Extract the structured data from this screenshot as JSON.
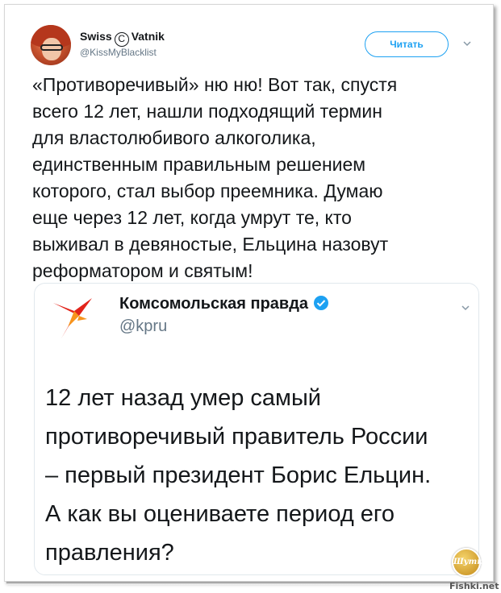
{
  "tweet": {
    "author_name_left": "Swiss",
    "author_name_symbol": "C",
    "author_name_right": "Vatnik",
    "author_handle": "@KissMyBlacklist",
    "follow_label": "Читать",
    "text": "«Противоречивый» ню ню! Вот так, спустя\nвсего 12 лет, нашли подходящий термин\nдля властолюбивого алкоголика,\nединственным правильным решением\nкоторого, стал выбор преемника. Думаю\nеще через 12 лет, когда умрут те, кто\nвыживал в девяностые, Ельцина назовут\nреформатором и святым!"
  },
  "quoted_tweet": {
    "author_name": "Комсомольская правда",
    "author_handle": "@kpru",
    "text": "12 лет назад умер самый\nпротиворечивый правитель России\n– первый президент Борис Ельцин.\nА как вы оцениваете период его\nправления?"
  },
  "watermark": {
    "badge": "Шутка",
    "site": "Fishki.net"
  },
  "colors": {
    "accent": "#1da1f2",
    "kp_red": "#e2231a",
    "kp_orange": "#f7941d",
    "verified": "#1da1f2"
  }
}
